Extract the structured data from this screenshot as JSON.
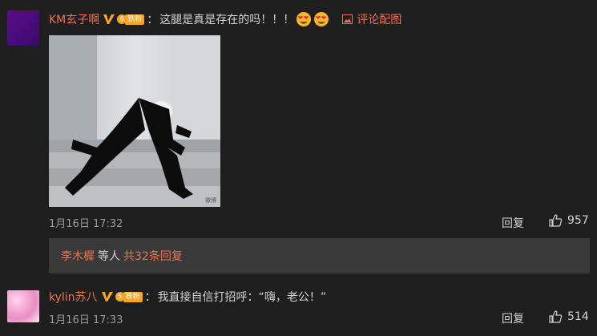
{
  "comments": [
    {
      "username": "KM玄子啊",
      "fan_level": "6",
      "fan_label": "铁粉",
      "text": "这腿是真是存在的吗！！！",
      "pic_link": "评论配图",
      "time": "1月16日 17:32",
      "reply_label": "回复",
      "likes": "957",
      "watermark": "微博",
      "sub_replies": {
        "user": "李木樨",
        "middle": "等人",
        "count_text": "共32条回复"
      }
    },
    {
      "username": "kylin苏八",
      "fan_level": "5",
      "fan_label": "铁粉",
      "text": "我直接自信打招呼：“嗨，老公！”",
      "time": "1月16日 17:33",
      "reply_label": "回复",
      "likes": "514"
    }
  ],
  "icons": {
    "vip": "vip-v-icon",
    "emoji": "heart-eyes-emoji-icon",
    "picture": "image-icon",
    "like": "thumbs-up-icon"
  },
  "colors": {
    "accent": "#eb7350",
    "background": "#1f1f1f",
    "badge": "#f6a623",
    "sub_bar": "#3a3a3a"
  }
}
